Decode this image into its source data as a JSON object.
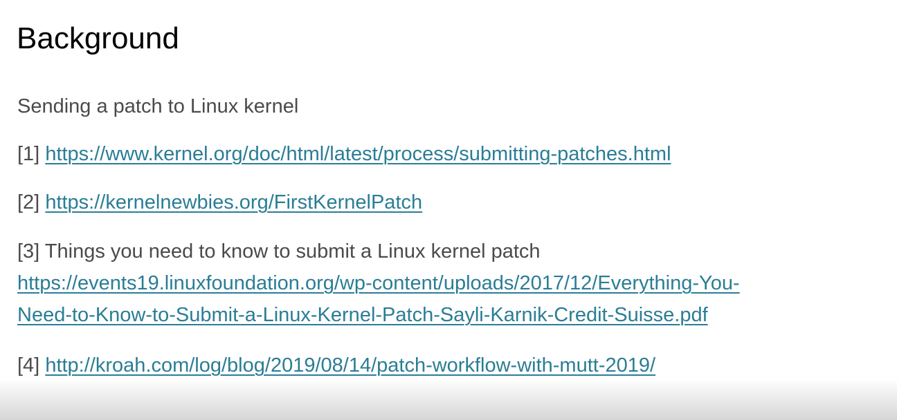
{
  "slide": {
    "title": "Background",
    "intro": "Sending a patch to Linux kernel",
    "references": [
      {
        "number": "[1]",
        "link": "https://www.kernel.org/doc/html/latest/process/submitting-patches.html"
      },
      {
        "number": "[2]",
        "link": "https://kernelnewbies.org/FirstKernelPatch"
      },
      {
        "number": "[3]",
        "text": "Things you need to know to submit a Linux kernel patch",
        "link_line1": "https://events19.linuxfoundation.org/wp-content/uploads/2017/12/Everything-You-",
        "link_line2": "Need-to-Know-to-Submit-a-Linux-Kernel-Patch-Sayli-Karnik-Credit-Suisse.pdf"
      },
      {
        "number": "[4]",
        "link": "http://kroah.com/log/blog/2019/08/14/patch-workflow-with-mutt-2019/"
      }
    ]
  },
  "colors": {
    "title": "#000000",
    "body_text": "#4a4a4a",
    "link": "#2a7d95"
  }
}
